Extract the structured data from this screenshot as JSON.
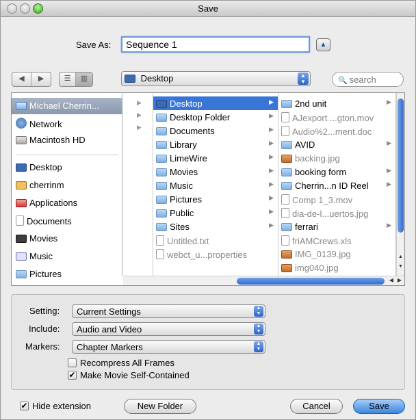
{
  "window": {
    "title": "Save"
  },
  "saveas": {
    "label": "Save As:",
    "value": "Sequence 1"
  },
  "location": {
    "selected": "Desktop"
  },
  "search": {
    "placeholder": "search"
  },
  "sidebar": {
    "items": [
      {
        "label": "Michael  Cherrin...",
        "icon": "computer-icon",
        "selected": true
      },
      {
        "label": "Network",
        "icon": "network-icon"
      },
      {
        "label": "Macintosh HD",
        "icon": "hard-disk-icon"
      },
      {
        "label": "Desktop",
        "icon": "desktop-icon"
      },
      {
        "label": "cherrinm",
        "icon": "home-icon"
      },
      {
        "label": "Applications",
        "icon": "applications-icon"
      },
      {
        "label": "Documents",
        "icon": "documents-icon"
      },
      {
        "label": "Movies",
        "icon": "movies-icon"
      },
      {
        "label": "Music",
        "icon": "music-icon"
      },
      {
        "label": "Pictures",
        "icon": "pictures-icon"
      }
    ]
  },
  "column2": {
    "items": [
      {
        "label": "Desktop",
        "selected": true,
        "folder": true
      },
      {
        "label": "Desktop Folder",
        "folder": true
      },
      {
        "label": "Documents",
        "folder": true
      },
      {
        "label": "Library",
        "folder": true
      },
      {
        "label": "LimeWire",
        "folder": true
      },
      {
        "label": "Movies",
        "folder": true
      },
      {
        "label": "Music",
        "folder": true
      },
      {
        "label": "Pictures",
        "folder": true
      },
      {
        "label": "Public",
        "folder": true
      },
      {
        "label": "Sites",
        "folder": true
      },
      {
        "label": "Untitled.txt",
        "folder": false
      },
      {
        "label": "webct_u...properties",
        "folder": false
      }
    ]
  },
  "column3": {
    "items": [
      {
        "label": "2nd unit",
        "folder": true
      },
      {
        "label": "AJexport ...gton.mov",
        "folder": false
      },
      {
        "label": "Audio%2...ment.doc",
        "folder": false
      },
      {
        "label": "AVID",
        "folder": true
      },
      {
        "label": "backing.jpg",
        "folder": false
      },
      {
        "label": "booking form",
        "folder": true
      },
      {
        "label": "Cherrin...n ID Reel",
        "folder": true
      },
      {
        "label": "Comp 1_3.mov",
        "folder": false
      },
      {
        "label": "dia-de-l...uertos.jpg",
        "folder": false
      },
      {
        "label": "ferrari",
        "folder": true
      },
      {
        "label": "friAMCrews.xls",
        "folder": false
      },
      {
        "label": "IMG_0139.jpg",
        "folder": false
      },
      {
        "label": "img040.jpg",
        "folder": false
      }
    ]
  },
  "options": {
    "setting_label": "Setting:",
    "setting_value": "Current Settings",
    "include_label": "Include:",
    "include_value": "Audio and Video",
    "markers_label": "Markers:",
    "markers_value": "Chapter Markers",
    "recompress_label": "Recompress All Frames",
    "recompress_checked": false,
    "selfcontained_label": "Make Movie Self-Contained",
    "selfcontained_checked": true
  },
  "footer": {
    "hide_ext_label": "Hide extension",
    "hide_ext_checked": true,
    "new_folder_label": "New Folder",
    "cancel_label": "Cancel",
    "save_label": "Save"
  }
}
